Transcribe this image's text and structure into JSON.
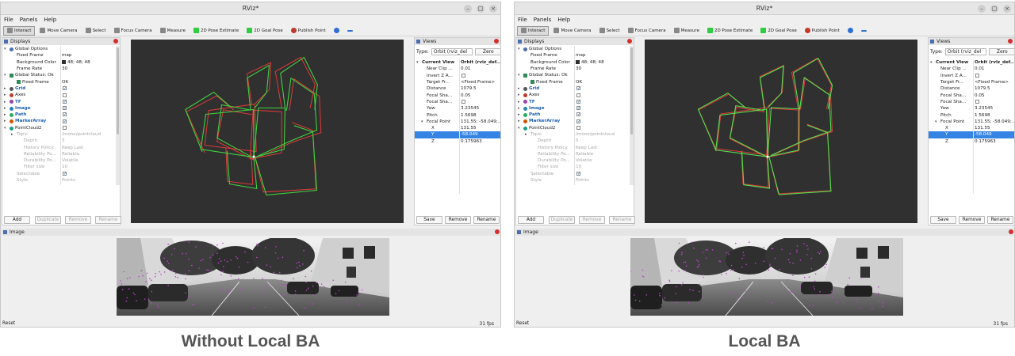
{
  "app": {
    "title": "RViz*",
    "menu": [
      "File",
      "Panels",
      "Help"
    ],
    "window_buttons": [
      "–",
      "□",
      "×"
    ]
  },
  "toolbar": [
    {
      "label": "Interact",
      "icon": "cursor-icon",
      "active": true
    },
    {
      "label": "Move Camera",
      "icon": "move-icon"
    },
    {
      "label": "Select",
      "icon": "select-icon"
    },
    {
      "label": "Focus Camera",
      "icon": "focus-icon"
    },
    {
      "label": "Measure",
      "icon": "ruler-icon"
    },
    {
      "label": "2D Pose Estimate",
      "icon": "green-arrow-icon"
    },
    {
      "label": "2D Goal Pose",
      "icon": "green-arrow-icon"
    },
    {
      "label": "Publish Point",
      "icon": "pin-icon"
    },
    {
      "label": "",
      "icon": "crosshair-icon"
    },
    {
      "label": "",
      "icon": "minus-icon"
    }
  ],
  "displays": {
    "title": "Displays",
    "rows": [
      {
        "key": "Global Options",
        "indent": 0,
        "arrow": "▾",
        "icon": "gear-icon",
        "style": "normal"
      },
      {
        "key": "Fixed Frame",
        "value": "map",
        "indent": 1,
        "style": "normal"
      },
      {
        "key": "Background Color",
        "value": "48; 48; 48",
        "swatch": true,
        "indent": 1,
        "style": "normal"
      },
      {
        "key": "Frame Rate",
        "value": "30",
        "indent": 1,
        "style": "normal"
      },
      {
        "key": "Global Status: Ok",
        "indent": 0,
        "arrow": "▾",
        "icon": "check-icon",
        "style": "normal"
      },
      {
        "key": "Fixed Frame",
        "value": "OK",
        "indent": 1,
        "icon": "check-icon",
        "style": "normal"
      },
      {
        "key": "Grid",
        "indent": 0,
        "arrow": "▸",
        "icon": "grid-icon",
        "check": "checked",
        "style": "blue"
      },
      {
        "key": "Axes",
        "indent": 0,
        "arrow": "▸",
        "icon": "axes-icon",
        "check": "unchecked",
        "style": "normal"
      },
      {
        "key": "TF",
        "indent": 0,
        "arrow": "▸",
        "icon": "tf-icon",
        "check": "checked",
        "style": "blue"
      },
      {
        "key": "Image",
        "indent": 0,
        "arrow": "▸",
        "icon": "image-icon",
        "check": "checked",
        "style": "blue"
      },
      {
        "key": "Path",
        "indent": 0,
        "arrow": "▸",
        "icon": "path-icon",
        "check": "checked",
        "style": "blue"
      },
      {
        "key": "MarkerArray",
        "indent": 0,
        "arrow": "▸",
        "icon": "marker-icon",
        "check": "checked",
        "style": "blue"
      },
      {
        "key": "PointCloud2",
        "indent": 0,
        "arrow": "▾",
        "icon": "pointcloud-icon",
        "check": "unchecked",
        "style": "normal"
      },
      {
        "key": "Topic",
        "value": "/mono/pointcloud",
        "indent": 1,
        "arrow": "▸",
        "style": "dim"
      },
      {
        "key": "Depth",
        "value": "5",
        "indent": 2,
        "style": "dim"
      },
      {
        "key": "History Policy",
        "value": "Keep Last",
        "indent": 2,
        "style": "dim"
      },
      {
        "key": "Reliability Po...",
        "value": "Reliable",
        "indent": 2,
        "style": "dim"
      },
      {
        "key": "Durability Po...",
        "value": "Volatile",
        "indent": 2,
        "style": "dim"
      },
      {
        "key": "Filter size",
        "value": "10",
        "indent": 2,
        "style": "dim"
      },
      {
        "key": "Selectable",
        "indent": 1,
        "check": "checked",
        "style": "dim"
      },
      {
        "key": "Style",
        "value": "Points",
        "indent": 1,
        "style": "dim"
      }
    ],
    "buttons": [
      {
        "label": "Add",
        "enabled": true
      },
      {
        "label": "Duplicate",
        "enabled": false
      },
      {
        "label": "Remove",
        "enabled": false
      },
      {
        "label": "Rename",
        "enabled": false
      }
    ]
  },
  "views": {
    "title": "Views",
    "type_label": "Type:",
    "type_value": "Orbit (rviz_del",
    "zero_label": "Zero",
    "rows": [
      {
        "key": "Current View",
        "value": "Orbit (rviz_def...",
        "indent": 0,
        "arrow": "▾",
        "bold": true
      },
      {
        "key": "Near Clip ...",
        "value": "0.01",
        "indent": 1
      },
      {
        "key": "Invert Z A...",
        "check": "unchecked",
        "indent": 1
      },
      {
        "key": "Target Fr...",
        "value": "<Fixed Frame>",
        "indent": 1
      },
      {
        "key": "Distance",
        "value": "1079.5",
        "indent": 1
      },
      {
        "key": "Focal Sha...",
        "value": "0.05",
        "indent": 1
      },
      {
        "key": "Focal Sha...",
        "check": "unchecked",
        "indent": 1
      },
      {
        "key": "Yaw",
        "value": "3.23545",
        "indent": 1
      },
      {
        "key": "Pitch",
        "value": "1.5698",
        "indent": 1
      },
      {
        "key": "Focal Point",
        "value": "131.55; -58.049;...",
        "indent": 1,
        "arrow": "▾"
      },
      {
        "key": "X",
        "value": "131.55",
        "indent": 2
      },
      {
        "key": "Y",
        "value": "-58.049",
        "indent": 2,
        "selected": true
      },
      {
        "key": "Z",
        "value": "0.175963",
        "indent": 2
      }
    ],
    "buttons": [
      {
        "label": "Save"
      },
      {
        "label": "Remove"
      },
      {
        "label": "Rename"
      }
    ]
  },
  "image_panel": {
    "title": "Image"
  },
  "status": {
    "reset_label": "Reset",
    "fps": "31 fps"
  },
  "colors": {
    "viewport_bg": "#303030",
    "path_ground_truth": "#e03a3a",
    "path_estimate": "#3fd13f",
    "path_estimate_local_ba": "#4fe04f",
    "selection": "#3584e4",
    "blue_label": "#1a5fb4"
  },
  "windows": [
    {
      "id": "a",
      "caption": "Without Local BA"
    },
    {
      "id": "b",
      "caption": "Local BA"
    }
  ]
}
